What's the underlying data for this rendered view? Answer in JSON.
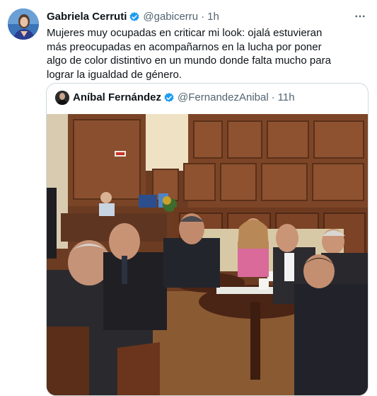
{
  "tweet": {
    "author_name": "Gabriela Cerruti",
    "handle": "@gabicerru",
    "separator": "·",
    "time": "1h",
    "more_icon": "more-horizontal-icon",
    "text": "Mujeres muy ocupadas en criticar mi look: ojalá estuvieran más preocupadas en acompañarnos en la lucha por poner algo de color distintivo en un mundo donde falta mucho para lograr la igualdad de género."
  },
  "quoted": {
    "author_name": "Aníbal Fernández",
    "handle": "@FernandezAnibal",
    "separator": "·",
    "time": "11h"
  },
  "colors": {
    "verified": "#1d9bf0",
    "muted_text": "#536471",
    "border": "#cfd9de"
  }
}
